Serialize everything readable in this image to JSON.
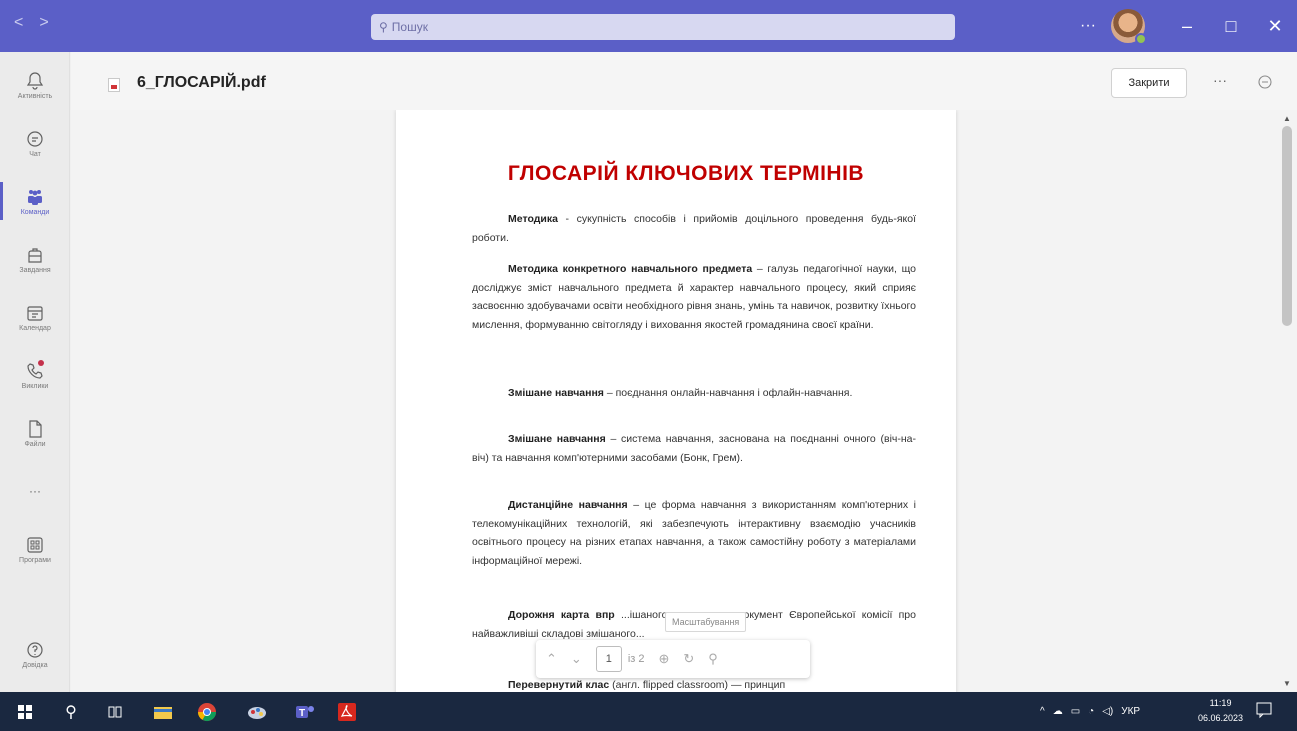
{
  "titlebar": {
    "back": "<",
    "forward": ">",
    "search_placeholder": "Пошук",
    "more": "···",
    "minimize": "–",
    "maximize": "□",
    "close": "✕"
  },
  "rail": {
    "activity": "Активність",
    "chat": "Чат",
    "teams": "Команди",
    "assignments": "Завдання",
    "calendar": "Календар",
    "calls": "Виклики",
    "files": "Файли",
    "more": "···",
    "apps": "Програми",
    "help": "Довідка"
  },
  "file": {
    "title": "6_ГЛОСАРІЙ.pdf",
    "close_label": "Закрити",
    "more": "···"
  },
  "document": {
    "title": "ГЛОСАРІЙ КЛЮЧОВИХ ТЕРМІНІВ",
    "entries": [
      {
        "term": "Методика",
        "definition": " - сукупність способів і прийомів доцільного проведення будь-якої роботи."
      },
      {
        "term": "Методика конкретного навчального предмета",
        "definition": " – галузь педагогічної науки, що досліджує зміст навчального предмета й характер навчального процесу, який сприяє засвоєнню здобувачами освіти необхідного рівня знань, умінь та навичок, розвитку їхнього мислення, формуванню світогляду і виховання якостей громадянина своєї країни."
      },
      {
        "term": "Змішане навчання",
        "definition": " – поєднання онлайн-навчання і офлайн-навчання."
      },
      {
        "term": "Змішане навчання",
        "definition": " – система навчання, заснована на поєднанні очного (віч-на-віч) та навчання комп'ютерними засобами (Бонк, Грем)."
      },
      {
        "term": "Дистанційне навчання",
        "definition": " – це форма навчання з використанням комп'ютерних і телекомунікаційних технологій, які забезпечують інтерактивну взаємодію учасників освітнього процесу на різних етапах навчання, а також самостійну роботу з матеріалами інформаційної мережі."
      },
      {
        "term": "Дорожня карта впр",
        "definition": " ...ішаного навчання – документ Європейської комісії про найважливіші складові змішаного..."
      },
      {
        "term": "Перевернутий клас",
        "definition": " (англ. flipped classroom) — принцип"
      }
    ]
  },
  "viewer": {
    "tooltip": "Масштабування",
    "page_number": "1",
    "page_of": "із 2"
  },
  "taskbar": {
    "lang": "УКР",
    "time": "11:19",
    "date": "06.06.2023"
  }
}
